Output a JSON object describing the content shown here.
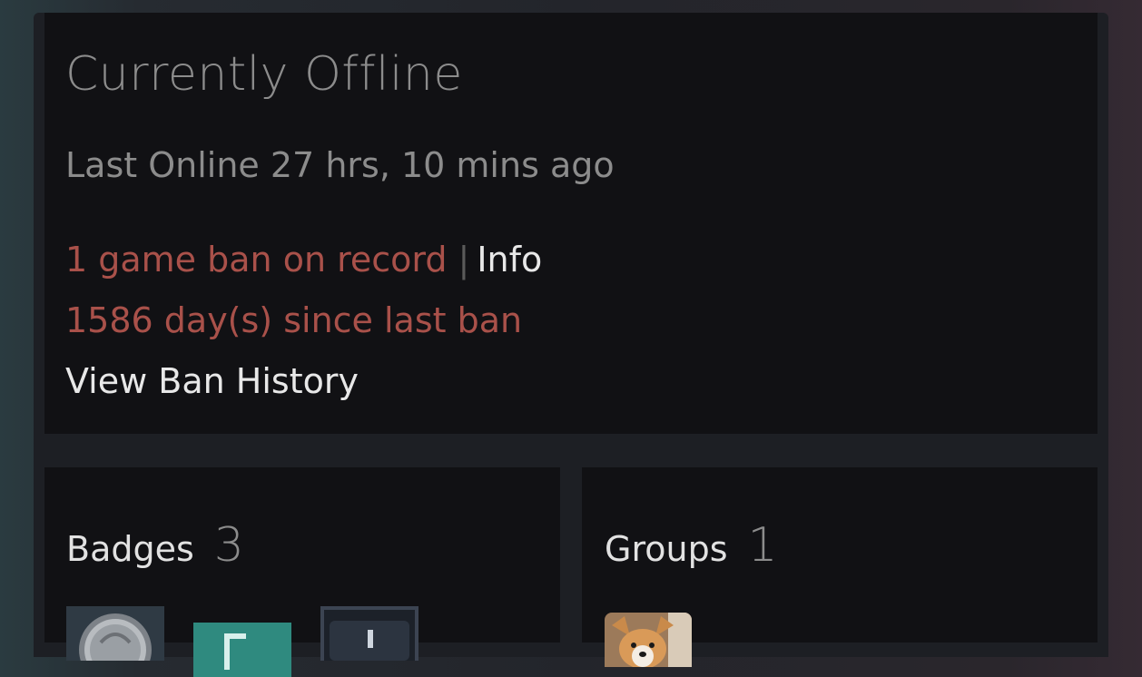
{
  "status": {
    "title": "Currently Offline",
    "last_online": "Last Online 27 hrs, 10 mins ago"
  },
  "bans": {
    "count_text": "1 game ban on record",
    "separator": "|",
    "info_link": "Info",
    "days_since": "1586 day(s) since last ban",
    "history_link": "View Ban History"
  },
  "badges": {
    "title": "Badges",
    "count": "3",
    "items": [
      "silver-coin-badge-icon",
      "teal-badge-icon",
      "dark-frame-badge-icon"
    ]
  },
  "groups": {
    "title": "Groups",
    "count": "1",
    "items": [
      "corgi-group-avatar"
    ]
  },
  "colors": {
    "ban_red": "#a9514a",
    "muted_text": "#8c8c8c",
    "bright_text": "#e8e8e8",
    "panel_bg": "#111114"
  }
}
